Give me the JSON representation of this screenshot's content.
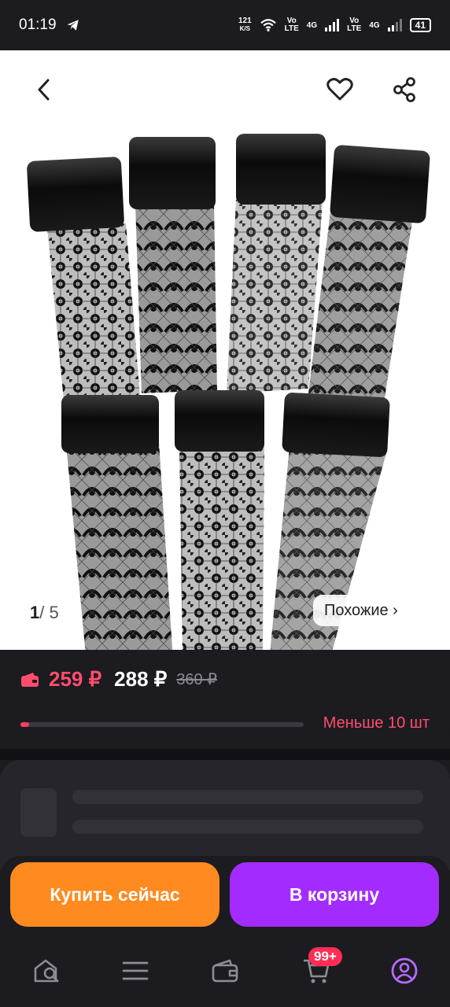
{
  "status_bar": {
    "time": "01:19",
    "net_speed_value": "121",
    "net_speed_unit": "K/S",
    "volte1_top": "Vo",
    "volte1_bottom": "LTE",
    "net1": "4G",
    "volte2_top": "Vo",
    "volte2_bottom": "LTE",
    "net2": "4G",
    "battery": "41",
    "icons": [
      "telegram-icon",
      "wifi-icon",
      "signal-icon",
      "battery-icon"
    ]
  },
  "gallery": {
    "current_index": "1",
    "separator": "/",
    "total": "5",
    "similar_label": "Похожие ›",
    "icons": [
      "back-icon",
      "heart-icon",
      "share-icon"
    ]
  },
  "price": {
    "card_price": "259 ₽",
    "regular_price": "288 ₽",
    "old_price": "360 ₽",
    "stock_label": "Меньше 10 шт",
    "stock_fraction": 0.03,
    "colors": {
      "accent_red": "#ff4d6d",
      "buy_orange": "#ff8a1f",
      "cart_purple": "#a42bff"
    }
  },
  "actions": {
    "buy_now": "Купить сейчас",
    "add_to_cart": "В корзину"
  },
  "navbar": {
    "cart_badge": "99+",
    "icons": [
      "home-search-icon",
      "catalog-icon",
      "wallet-icon",
      "cart-icon",
      "profile-icon"
    ]
  }
}
